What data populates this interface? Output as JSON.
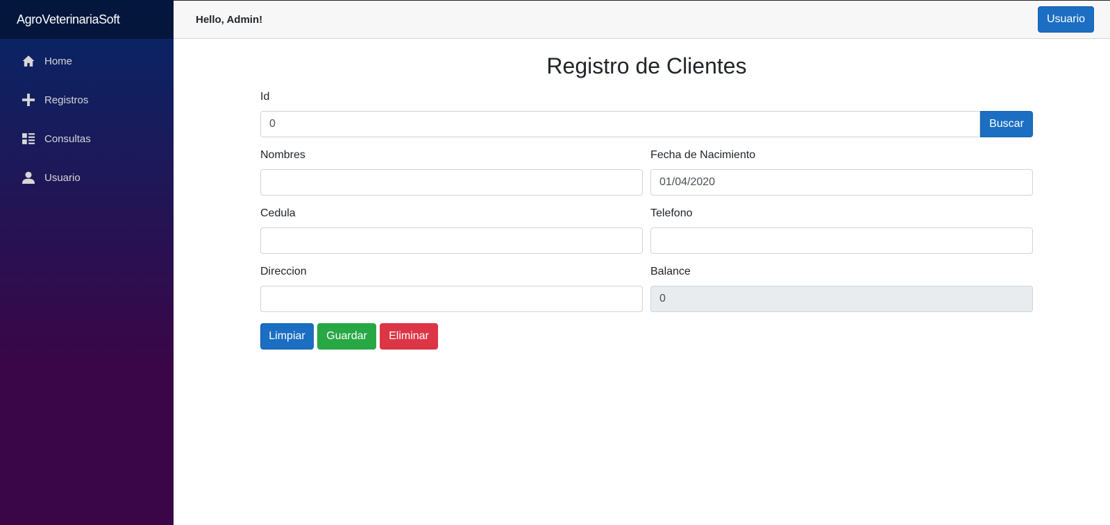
{
  "app": {
    "brand": "AgroVeterinariaSoft"
  },
  "sidebar": {
    "items": [
      {
        "label": "Home",
        "icon": "home-icon"
      },
      {
        "label": "Registros",
        "icon": "plus-icon"
      },
      {
        "label": "Consultas",
        "icon": "list-icon"
      },
      {
        "label": "Usuario",
        "icon": "person-icon"
      }
    ]
  },
  "topbar": {
    "greeting": "Hello, Admin!",
    "user_button": "Usuario"
  },
  "form": {
    "title": "Registro de Clientes",
    "id": {
      "label": "Id",
      "value": "0",
      "search_button": "Buscar"
    },
    "nombres": {
      "label": "Nombres",
      "value": ""
    },
    "fecha": {
      "label": "Fecha de Nacimiento",
      "value": "01/04/2020"
    },
    "cedula": {
      "label": "Cedula",
      "value": ""
    },
    "telefono": {
      "label": "Telefono",
      "value": ""
    },
    "direccion": {
      "label": "Direccion",
      "value": ""
    },
    "balance": {
      "label": "Balance",
      "value": "0"
    },
    "buttons": {
      "limpiar": "Limpiar",
      "guardar": "Guardar",
      "eliminar": "Eliminar"
    }
  },
  "colors": {
    "primary": "#1b6ec2",
    "success": "#28a745",
    "danger": "#dc3545",
    "sidebar_top": "#052767",
    "sidebar_bottom": "#3a0647"
  }
}
